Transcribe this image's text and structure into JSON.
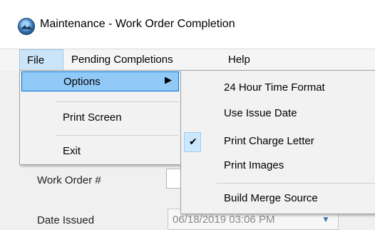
{
  "window": {
    "title": "Maintenance - Work Order Completion",
    "icon": "maintenance-app-icon"
  },
  "menubar": {
    "items": [
      {
        "label": "File"
      },
      {
        "label": "Pending Completions"
      },
      {
        "label": "Help"
      }
    ]
  },
  "file_menu": {
    "items": [
      {
        "label": "Options",
        "submenu_arrow": "▶"
      },
      {
        "label": "Print Screen"
      },
      {
        "label": "Exit"
      }
    ]
  },
  "options_submenu": {
    "items": [
      {
        "label": "24 Hour Time Format",
        "checked": false
      },
      {
        "label": "Use Issue Date",
        "checked": false
      },
      {
        "label": "Print Charge Letter",
        "checked": true
      },
      {
        "label": "Print Images",
        "checked": false
      },
      {
        "label": "Build Merge Source",
        "checked": false
      }
    ],
    "check_glyph": "✔"
  },
  "form": {
    "work_order_label": "Work Order #",
    "date_issued_label": "Date Issued",
    "date_issued_value": "06/18/2019 03:06 PM",
    "dropdown_arrow": "▼"
  },
  "colors": {
    "menu_highlight": "#91c9f7",
    "menu_highlight_border": "#0078d7",
    "check_background": "#cce8ff"
  }
}
